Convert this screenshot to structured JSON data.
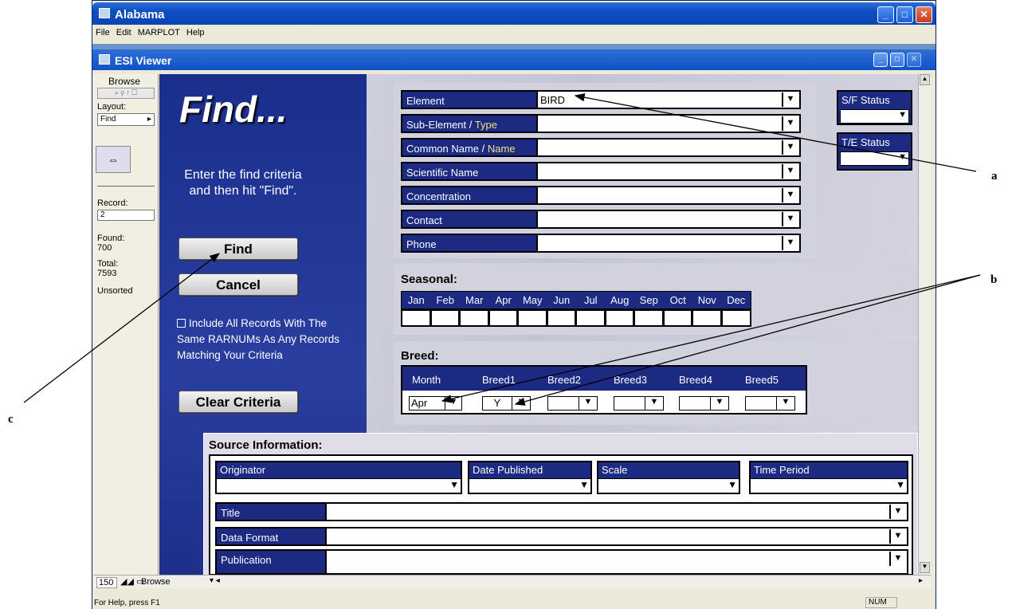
{
  "app": {
    "title": "Alabama",
    "window_title": "ESI Viewer"
  },
  "menu": [
    "File",
    "Edit",
    "MARPLOT",
    "Help"
  ],
  "sidebar": {
    "mode": "Browse",
    "layout_label": "Layout:",
    "layout_value": "Find",
    "record_label": "Record:",
    "record_value": "2",
    "found_label": "Found:",
    "found_value": "700",
    "total_label": "Total:",
    "total_value": "7593",
    "sort_status": "Unsorted"
  },
  "find": {
    "title": "Find...",
    "instructions": "Enter the find criteria and then hit \"Find\".",
    "find_button": "Find",
    "cancel_button": "Cancel",
    "include_label": "Include All Records With The Same RARNUMs As Any Records Matching Your Criteria",
    "clear_button": "Clear Criteria"
  },
  "fields": {
    "element": {
      "label": "Element",
      "value": "BIRD"
    },
    "sub_element": {
      "label": "Sub-Element /",
      "label_alt": "Type",
      "value": ""
    },
    "common_name": {
      "label": "Common Name /",
      "label_alt": "Name",
      "value": ""
    },
    "scientific_name": {
      "label": "Scientific Name",
      "value": ""
    },
    "concentration": {
      "label": "Concentration",
      "value": ""
    },
    "contact": {
      "label": "Contact",
      "value": ""
    },
    "phone": {
      "label": "Phone",
      "value": ""
    },
    "sf_status": {
      "label": "S/F Status",
      "value": ""
    },
    "te_status": {
      "label": "T/E Status",
      "value": ""
    }
  },
  "seasonal": {
    "title": "Seasonal:",
    "months": [
      "Jan",
      "Feb",
      "Mar",
      "Apr",
      "May",
      "Jun",
      "Jul",
      "Aug",
      "Sep",
      "Oct",
      "Nov",
      "Dec"
    ]
  },
  "breed": {
    "title": "Breed:",
    "columns": [
      "Month",
      "Breed1",
      "Breed2",
      "Breed3",
      "Breed4",
      "Breed5"
    ],
    "values": [
      "Apr",
      "Y",
      "",
      "",
      "",
      ""
    ]
  },
  "source": {
    "title": "Source Information:",
    "originator": "Originator",
    "date_published": "Date Published",
    "scale": "Scale",
    "time_period": "Time Period",
    "title_label": "Title",
    "data_format": "Data Format",
    "publication": "Publication"
  },
  "bottom": {
    "zoom": "150",
    "mode": "Browse"
  },
  "status": {
    "help": "For Help, press F1",
    "num": "NUM"
  },
  "annotations": {
    "a": "a",
    "b": "b",
    "c": "c"
  }
}
